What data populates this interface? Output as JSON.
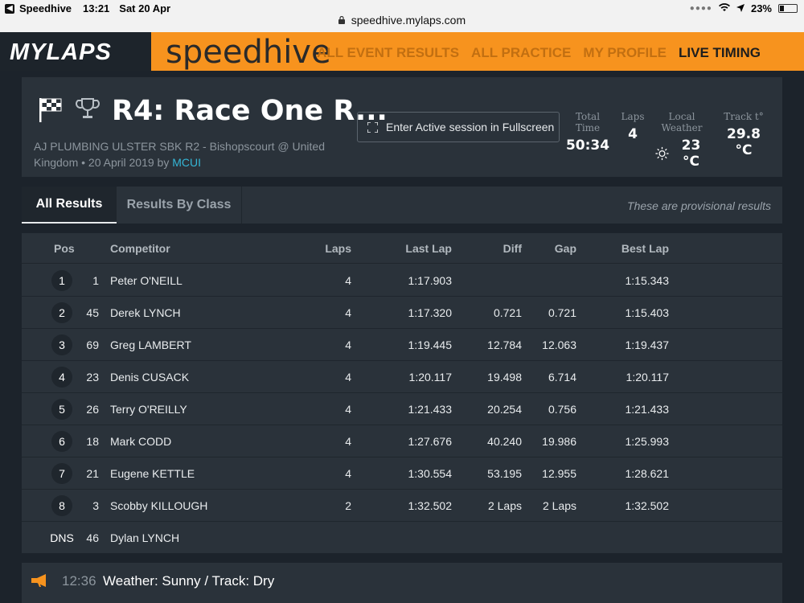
{
  "status_bar": {
    "app": "Speedhive",
    "time": "13:21",
    "date": "Sat 20 Apr",
    "battery": "23%",
    "url": "speedhive.mylaps.com"
  },
  "header": {
    "logo_primary": "MYLAPS",
    "logo_secondary": "speedhive",
    "accent_color": "#f7931e",
    "nav": [
      {
        "label": "ALL EVENT RESULTS",
        "active": false
      },
      {
        "label": "ALL PRACTICE",
        "active": false
      },
      {
        "label": "MY PROFILE",
        "active": false
      },
      {
        "label": "LIVE TIMING",
        "active": true
      }
    ]
  },
  "event": {
    "title": "R4: Race One R...",
    "subtitle": "AJ PLUMBING ULSTER SBK R2 - Bishopscourt @ United Kingdom • 20 April 2019 by",
    "organizer": "MCUI",
    "fullscreen_label": "Enter Active session in Fullscreen",
    "icons": [
      "checkered-flag-icon",
      "trophy-icon",
      "fullscreen-icon",
      "sun-icon"
    ],
    "stats": {
      "total_time_label": "Total Time",
      "total_time": "50:34",
      "laps_label": "Laps",
      "laps": "4",
      "weather_label": "Local Weather",
      "weather": "23 °C",
      "track_label": "Track t°",
      "track": "29.8 °C"
    }
  },
  "tabs": {
    "all_results": "All Results",
    "results_by_class": "Results By Class",
    "provisional_note": "These are provisional results"
  },
  "table": {
    "headers": {
      "pos": "Pos",
      "competitor": "Competitor",
      "laps": "Laps",
      "last_lap": "Last Lap",
      "diff": "Diff",
      "gap": "Gap",
      "best_lap": "Best Lap"
    },
    "rows": [
      {
        "pos": "1",
        "num": "1",
        "name": "Peter O'NEILL",
        "laps": "4",
        "last": "1:17.903",
        "diff": "",
        "gap": "",
        "best": "1:15.343"
      },
      {
        "pos": "2",
        "num": "45",
        "name": "Derek LYNCH",
        "laps": "4",
        "last": "1:17.320",
        "diff": "0.721",
        "gap": "0.721",
        "best": "1:15.403"
      },
      {
        "pos": "3",
        "num": "69",
        "name": "Greg LAMBERT",
        "laps": "4",
        "last": "1:19.445",
        "diff": "12.784",
        "gap": "12.063",
        "best": "1:19.437"
      },
      {
        "pos": "4",
        "num": "23",
        "name": "Denis CUSACK",
        "laps": "4",
        "last": "1:20.117",
        "diff": "19.498",
        "gap": "6.714",
        "best": "1:20.117"
      },
      {
        "pos": "5",
        "num": "26",
        "name": "Terry O'REILLY",
        "laps": "4",
        "last": "1:21.433",
        "diff": "20.254",
        "gap": "0.756",
        "best": "1:21.433"
      },
      {
        "pos": "6",
        "num": "18",
        "name": "Mark CODD",
        "laps": "4",
        "last": "1:27.676",
        "diff": "40.240",
        "gap": "19.986",
        "best": "1:25.993"
      },
      {
        "pos": "7",
        "num": "21",
        "name": "Eugene KETTLE",
        "laps": "4",
        "last": "1:30.554",
        "diff": "53.195",
        "gap": "12.955",
        "best": "1:28.621"
      },
      {
        "pos": "8",
        "num": "3",
        "name": "Scobby KILLOUGH",
        "laps": "2",
        "last": "1:32.502",
        "diff": "2 Laps",
        "gap": "2 Laps",
        "best": "1:32.502"
      },
      {
        "pos": "DNS",
        "num": "46",
        "name": "Dylan LYNCH",
        "laps": "",
        "last": "",
        "diff": "",
        "gap": "",
        "best": ""
      }
    ]
  },
  "announcement": {
    "icon": "megaphone-icon",
    "time": "12:36",
    "text": "Weather: Sunny / Track: Dry"
  }
}
